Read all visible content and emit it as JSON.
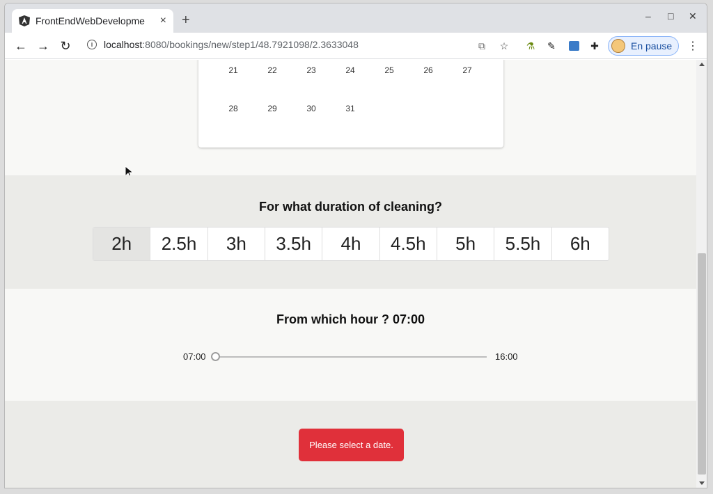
{
  "browser": {
    "tab_title": "FrontEndWebDevelopme",
    "tab_close": "×",
    "new_tab": "+",
    "url_host": "localhost",
    "url_path": ":8080/bookings/new/step1/48.7921098/2.3633048",
    "profile_label": "En pause",
    "window_controls": {
      "minimize": "–",
      "maximize": "□",
      "close": "✕"
    },
    "icons": [
      "translate-icon",
      "star-icon",
      "flask-icon",
      "extension-icon",
      "css-icon",
      "puzzle-icon"
    ]
  },
  "calendar": {
    "rows": [
      [
        "21",
        "22",
        "23",
        "24",
        "25",
        "26",
        "27"
      ],
      [
        "28",
        "29",
        "30",
        "31"
      ]
    ]
  },
  "duration": {
    "title": "For what duration of cleaning?",
    "options": [
      "2h",
      "2.5h",
      "3h",
      "3.5h",
      "4h",
      "4.5h",
      "5h",
      "5.5h",
      "6h"
    ],
    "selected": "2h"
  },
  "hour": {
    "title": "From which hour ? 07:00",
    "min_label": "07:00",
    "max_label": "16:00",
    "value_fraction": 0
  },
  "footer": {
    "alert_label": "Please select a date."
  },
  "colors": {
    "alert": "#e0303a",
    "active_duration": "#e4e4e2"
  }
}
